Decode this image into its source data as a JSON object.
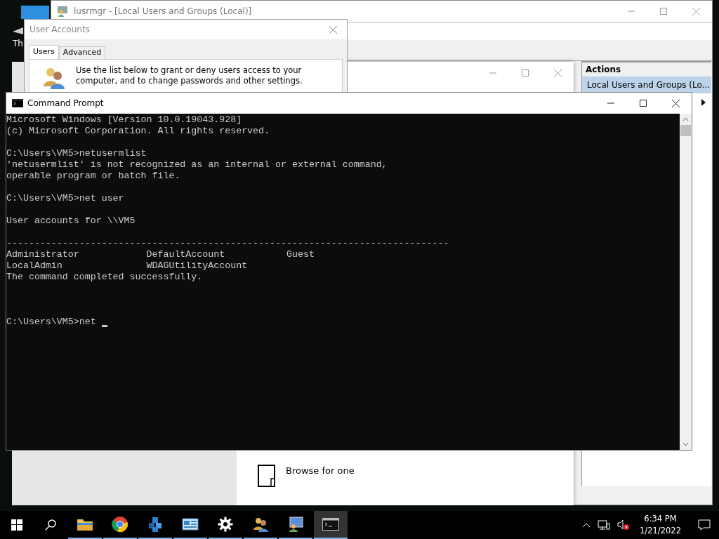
{
  "desktop": {
    "icon_label": "Th"
  },
  "lusrmgr": {
    "title": "lusrmgr - [Local Users and Groups (Local)]",
    "actions": {
      "header": "Actions",
      "items": [
        {
          "label": "Local Users and Groups (Lo...",
          "selected": true
        }
      ]
    }
  },
  "settings_window": {
    "browse_label": "Browse for one"
  },
  "user_accounts": {
    "title": "User Accounts",
    "tabs": [
      {
        "label": "Users",
        "selected": true
      },
      {
        "label": "Advanced",
        "selected": false
      }
    ],
    "description": "Use the list below to grant or deny users access to your computer, and to change passwords and other settings."
  },
  "command_prompt": {
    "title": "Command Prompt",
    "blocks": [
      {
        "kind": "output",
        "lines": [
          "Microsoft Windows [Version 10.0.19043.928]",
          "(c) Microsoft Corporation. All rights reserved."
        ]
      },
      {
        "kind": "output",
        "lines": [
          "C:\\Users\\VM5>netusermlist",
          "'netusermlist' is not recognized as an internal or external command,",
          "operable program or batch file."
        ]
      },
      {
        "kind": "output",
        "lines": [
          "C:\\Users\\VM5>net user"
        ]
      },
      {
        "kind": "output",
        "lines": [
          "User accounts for \\\\VM5"
        ]
      },
      {
        "kind": "output",
        "lines": [
          "-------------------------------------------------------------------------------",
          "Administrator            DefaultAccount           Guest",
          "LocalAdmin               WDAGUtilityAccount",
          "The command completed successfully."
        ]
      },
      {
        "kind": "prompt",
        "lines": [
          "C:\\Users\\VM5>net "
        ]
      }
    ]
  },
  "taskbar": {
    "apps": [
      {
        "kind": "explorer",
        "running": true,
        "active": false
      },
      {
        "kind": "browser",
        "running": true,
        "active": false
      },
      {
        "kind": "cube",
        "running": true,
        "active": false
      },
      {
        "kind": "panel",
        "running": true,
        "active": false
      },
      {
        "kind": "gear",
        "running": true,
        "active": false
      },
      {
        "kind": "users",
        "running": true,
        "active": false
      },
      {
        "kind": "monitor",
        "running": true,
        "active": false
      },
      {
        "kind": "terminal",
        "running": true,
        "active": true
      }
    ],
    "time": "6:34 PM",
    "date": "1/21/2022"
  }
}
